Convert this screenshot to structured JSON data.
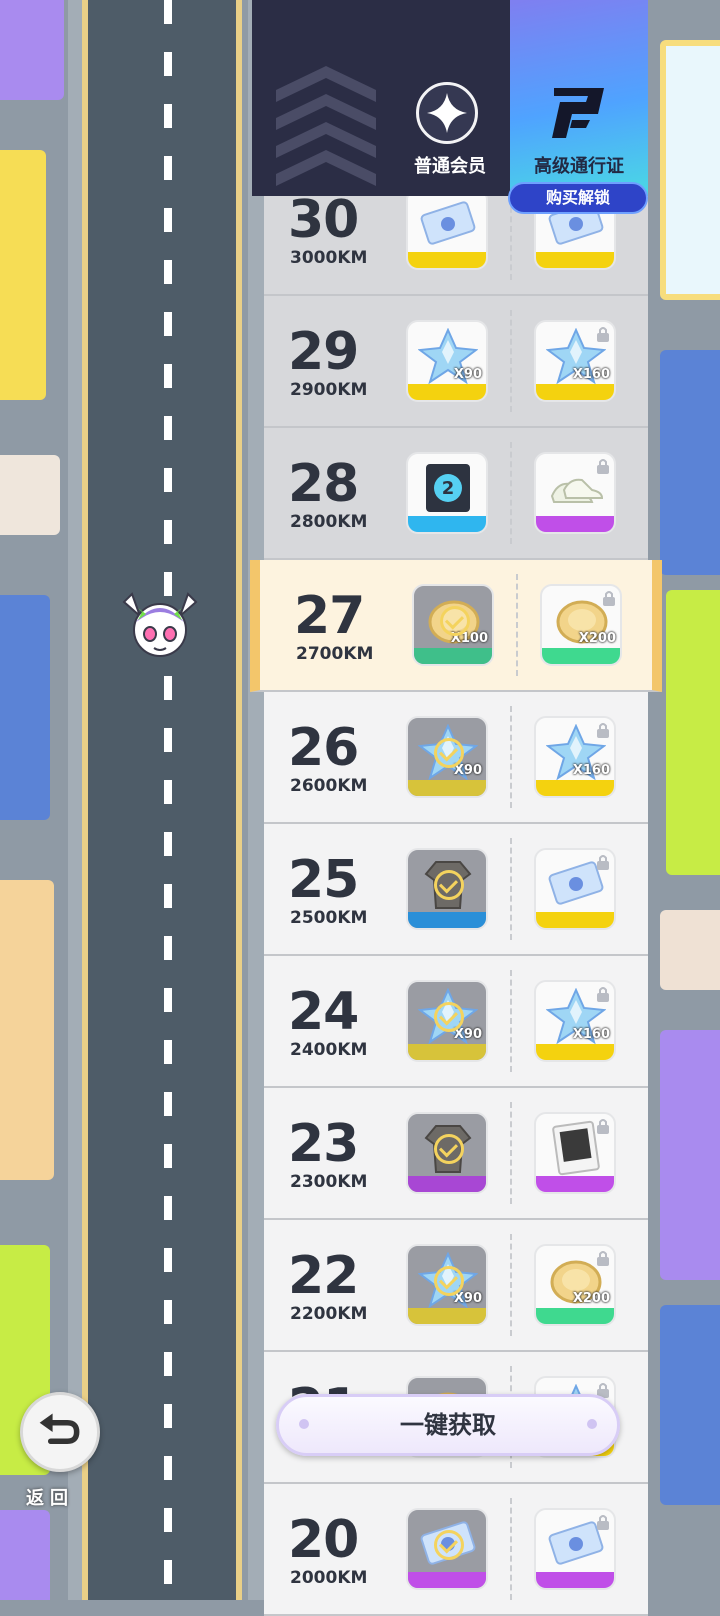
{
  "header": {
    "free_label": "普通会员",
    "premium_label": "高级通行证",
    "buy_button": "购买解锁"
  },
  "levels": [
    {
      "level": "30",
      "km": "3000KM",
      "free": {
        "icon": "ticket-icon",
        "qty": "",
        "claimed": false,
        "color": "#f4d20f"
      },
      "premium": {
        "icon": "ticket-icon",
        "qty": "",
        "locked": true,
        "color": "#f4d20f"
      }
    },
    {
      "level": "29",
      "km": "2900KM",
      "free": {
        "icon": "star-gem-icon",
        "qty": "X90",
        "claimed": false,
        "color": "#f4d20f"
      },
      "premium": {
        "icon": "star-gem-icon",
        "qty": "X160",
        "locked": true,
        "color": "#f4d20f"
      }
    },
    {
      "level": "28",
      "km": "2800KM",
      "free": {
        "icon": "card-2-icon",
        "qty": "",
        "claimed": false,
        "color": "#2fb6ef"
      },
      "premium": {
        "icon": "shoes-icon",
        "qty": "",
        "locked": true,
        "color": "#c04fe8"
      }
    },
    {
      "level": "27",
      "km": "2700KM",
      "current": true,
      "free": {
        "icon": "coin-icon",
        "qty": "X100",
        "claimed": true,
        "color": "#3fbf8a"
      },
      "premium": {
        "icon": "coin-icon",
        "qty": "X200",
        "locked": true,
        "color": "#3fd98f"
      }
    },
    {
      "level": "26",
      "km": "2600KM",
      "free": {
        "icon": "star-gem-icon",
        "qty": "X90",
        "claimed": true,
        "color": "#d7c33a"
      },
      "premium": {
        "icon": "star-gem-icon",
        "qty": "X160",
        "locked": true,
        "color": "#f4d20f"
      }
    },
    {
      "level": "25",
      "km": "2500KM",
      "free": {
        "icon": "outfit-icon",
        "qty": "",
        "claimed": true,
        "color": "#2a8fd8"
      },
      "premium": {
        "icon": "ticket-icon",
        "qty": "",
        "locked": true,
        "color": "#f4d20f"
      }
    },
    {
      "level": "24",
      "km": "2400KM",
      "free": {
        "icon": "star-gem-icon",
        "qty": "X90",
        "claimed": true,
        "color": "#d7c33a"
      },
      "premium": {
        "icon": "star-gem-icon",
        "qty": "X160",
        "locked": true,
        "color": "#f4d20f"
      }
    },
    {
      "level": "23",
      "km": "2300KM",
      "free": {
        "icon": "outfit-icon",
        "qty": "",
        "claimed": true,
        "color": "#a847d4"
      },
      "premium": {
        "icon": "photo-card-icon",
        "qty": "",
        "locked": true,
        "color": "#c04fe8"
      }
    },
    {
      "level": "22",
      "km": "2200KM",
      "free": {
        "icon": "star-gem-icon",
        "qty": "X90",
        "claimed": true,
        "color": "#d7c33a"
      },
      "premium": {
        "icon": "coin-icon",
        "qty": "X200",
        "locked": true,
        "color": "#3fd98f"
      }
    },
    {
      "level": "21",
      "km": "",
      "free": {
        "icon": "coin-icon",
        "qty": "",
        "claimed": true,
        "color": "#d7c33a"
      },
      "premium": {
        "icon": "star-gem-icon",
        "qty": "",
        "locked": true,
        "color": "#f4d20f"
      }
    },
    {
      "level": "20",
      "km": "2000KM",
      "free": {
        "icon": "ticket-icon",
        "qty": "",
        "claimed": true,
        "color": "#c04fe8"
      },
      "premium": {
        "icon": "ticket-icon",
        "qty": "",
        "locked": true,
        "color": "#c04fe8"
      }
    }
  ],
  "claim_all_button": "一键获取",
  "back_label": "返回"
}
